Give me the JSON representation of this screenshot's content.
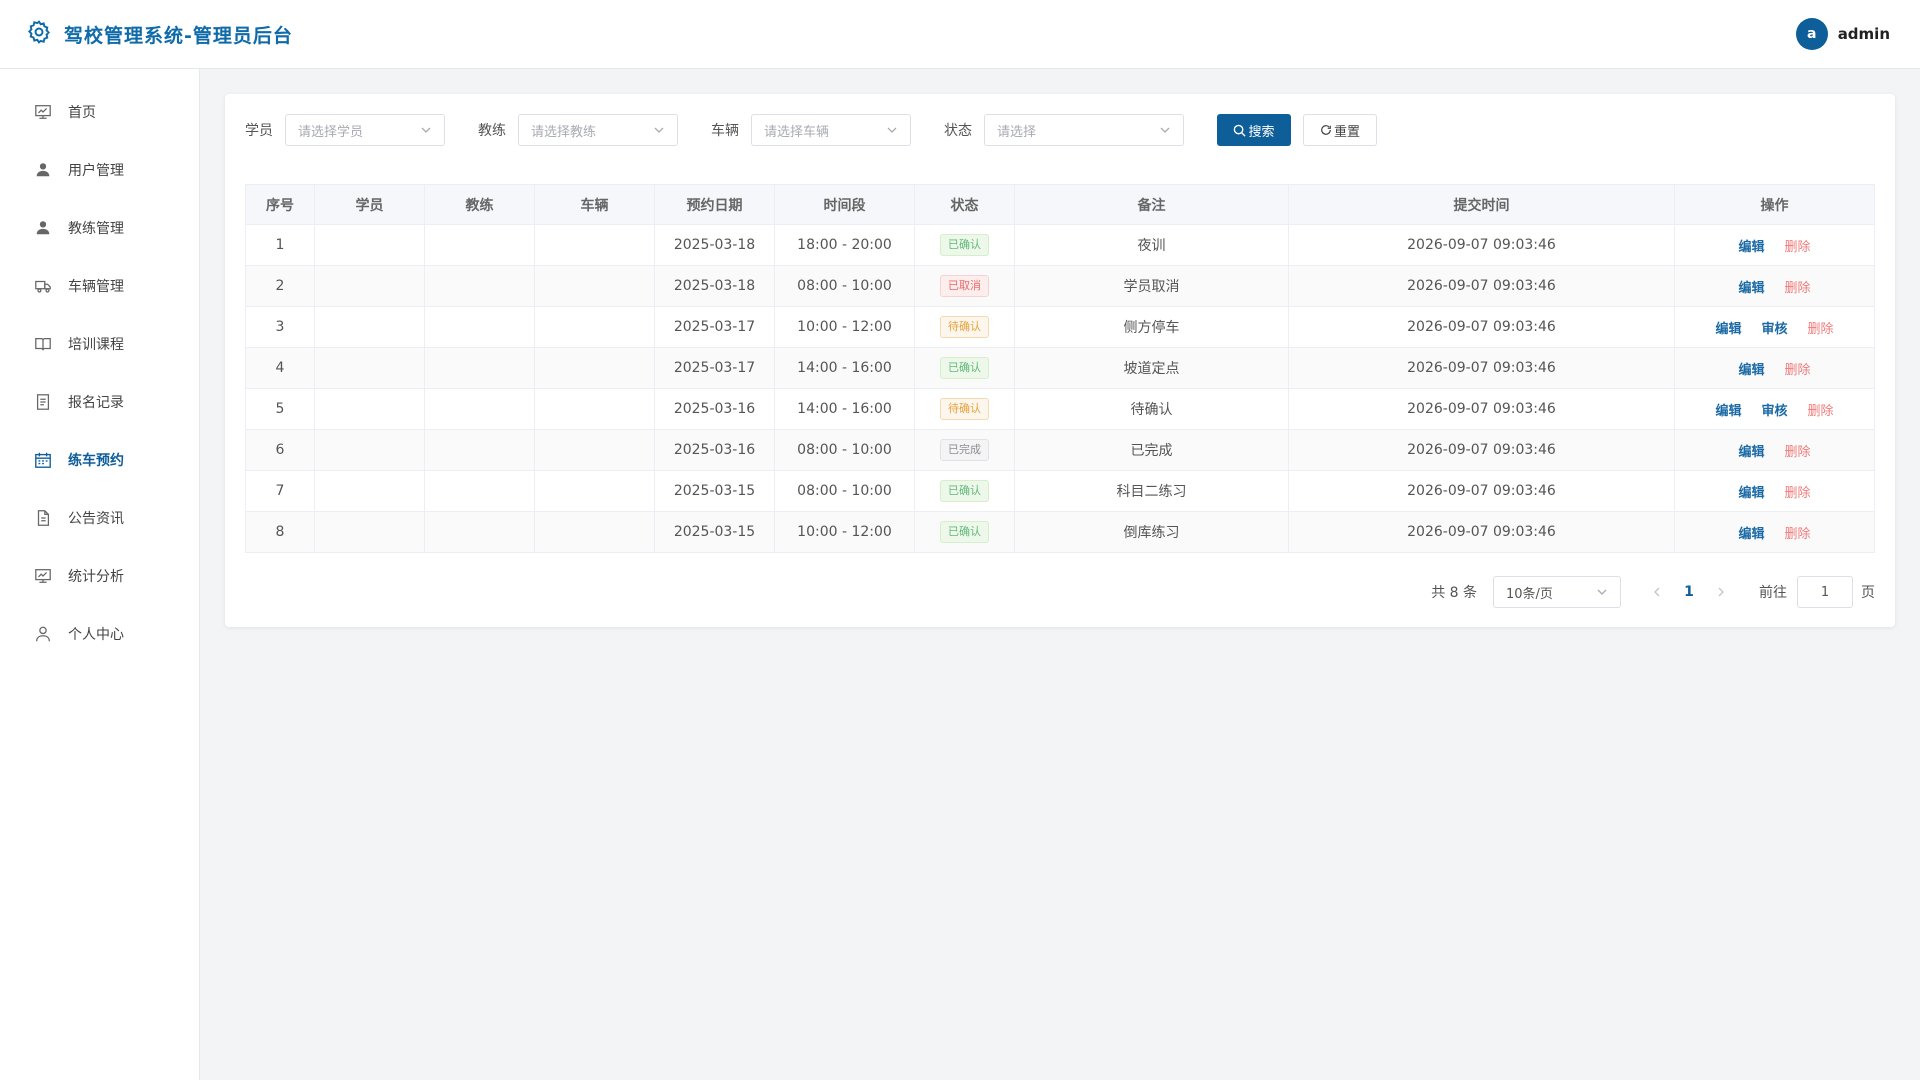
{
  "app": {
    "title": "驾校管理系统-管理员后台"
  },
  "user": {
    "avatar_letter": "a",
    "name": "admin"
  },
  "sidebar": {
    "items": [
      {
        "label": "首页",
        "icon": "dashboard-icon",
        "active": false
      },
      {
        "label": "用户管理",
        "icon": "user-icon",
        "active": false
      },
      {
        "label": "教练管理",
        "icon": "coach-icon",
        "active": false
      },
      {
        "label": "车辆管理",
        "icon": "truck-icon",
        "active": false
      },
      {
        "label": "培训课程",
        "icon": "book-icon",
        "active": false
      },
      {
        "label": "报名记录",
        "icon": "document-icon",
        "active": false
      },
      {
        "label": "练车预约",
        "icon": "calendar-icon",
        "active": true
      },
      {
        "label": "公告资讯",
        "icon": "notice-icon",
        "active": false
      },
      {
        "label": "统计分析",
        "icon": "chart-icon",
        "active": false
      },
      {
        "label": "个人中心",
        "icon": "person-icon",
        "active": false
      }
    ]
  },
  "filters": {
    "student_label": "学员",
    "student_placeholder": "请选择学员",
    "coach_label": "教练",
    "coach_placeholder": "请选择教练",
    "vehicle_label": "车辆",
    "vehicle_placeholder": "请选择车辆",
    "status_label": "状态",
    "status_placeholder": "请选择",
    "search_label": "搜索",
    "reset_label": "重置"
  },
  "table": {
    "headers": [
      "序号",
      "学员",
      "教练",
      "车辆",
      "预约日期",
      "时间段",
      "状态",
      "备注",
      "提交时间",
      "操作"
    ],
    "rows": [
      {
        "no": "1",
        "student": "",
        "coach": "",
        "vehicle": "",
        "date": "2025-03-18",
        "slot": "18:00 - 20:00",
        "status": "已确认",
        "status_type": "success",
        "remark": "夜训",
        "submitted": "2026-09-07 09:03:46",
        "audit": false
      },
      {
        "no": "2",
        "student": "",
        "coach": "",
        "vehicle": "",
        "date": "2025-03-18",
        "slot": "08:00 - 10:00",
        "status": "已取消",
        "status_type": "danger",
        "remark": "学员取消",
        "submitted": "2026-09-07 09:03:46",
        "audit": false
      },
      {
        "no": "3",
        "student": "",
        "coach": "",
        "vehicle": "",
        "date": "2025-03-17",
        "slot": "10:00 - 12:00",
        "status": "待确认",
        "status_type": "warning",
        "remark": "侧方停车",
        "submitted": "2026-09-07 09:03:46",
        "audit": true
      },
      {
        "no": "4",
        "student": "",
        "coach": "",
        "vehicle": "",
        "date": "2025-03-17",
        "slot": "14:00 - 16:00",
        "status": "已确认",
        "status_type": "success",
        "remark": "坡道定点",
        "submitted": "2026-09-07 09:03:46",
        "audit": false
      },
      {
        "no": "5",
        "student": "",
        "coach": "",
        "vehicle": "",
        "date": "2025-03-16",
        "slot": "14:00 - 16:00",
        "status": "待确认",
        "status_type": "warning",
        "remark": "待确认",
        "submitted": "2026-09-07 09:03:46",
        "audit": true
      },
      {
        "no": "6",
        "student": "",
        "coach": "",
        "vehicle": "",
        "date": "2025-03-16",
        "slot": "08:00 - 10:00",
        "status": "已完成",
        "status_type": "info",
        "remark": "已完成",
        "submitted": "2026-09-07 09:03:46",
        "audit": false
      },
      {
        "no": "7",
        "student": "",
        "coach": "",
        "vehicle": "",
        "date": "2025-03-15",
        "slot": "08:00 - 10:00",
        "status": "已确认",
        "status_type": "success",
        "remark": "科目二练习",
        "submitted": "2026-09-07 09:03:46",
        "audit": false
      },
      {
        "no": "8",
        "student": "",
        "coach": "",
        "vehicle": "",
        "date": "2025-03-15",
        "slot": "10:00 - 12:00",
        "status": "已确认",
        "status_type": "success",
        "remark": "倒库练习",
        "submitted": "2026-09-07 09:03:46",
        "audit": false
      }
    ],
    "actions": {
      "edit": "编辑",
      "audit": "审核",
      "delete": "删除"
    }
  },
  "pagination": {
    "total_text": "共 8 条",
    "page_size": "10条/页",
    "current_page": "1",
    "goto_label": "前往",
    "goto_value": "1",
    "page_suffix": "页"
  },
  "colors": {
    "primary": "#0e5e9a",
    "danger": "#ef7a7a",
    "success": "#5fb878",
    "warning": "#e6a23c"
  }
}
